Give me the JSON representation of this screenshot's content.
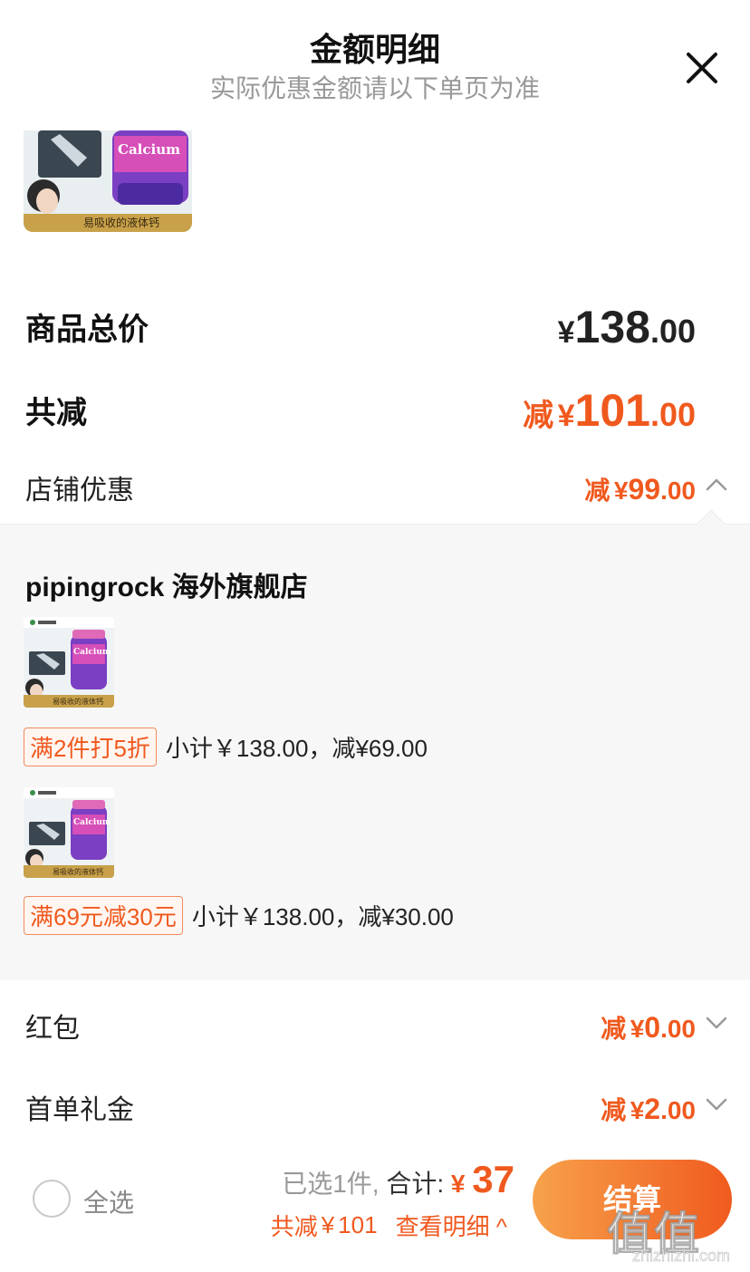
{
  "header": {
    "title": "金额明细",
    "subtitle": "实际优惠金额请以下单页为准"
  },
  "top_product": {
    "banner_text": "易吸收的液体钙",
    "bottle_label": "Calcium"
  },
  "summary_rows": {
    "total": {
      "label": "商品总价",
      "yen": "¥",
      "integer": "138",
      "decimal": ".00"
    },
    "reduce": {
      "label": "共减",
      "prefix": "减",
      "yen": "¥",
      "integer": "101",
      "decimal": ".00"
    },
    "shop_discount": {
      "label": "店铺优惠",
      "prefix": "减",
      "yen": "¥",
      "integer": "99",
      "decimal": ".00",
      "expanded": true
    }
  },
  "detail": {
    "shop_name": "pipingrock 海外旗舰店",
    "items": [
      {
        "banner_text": "易吸收的液体钙",
        "bottle_label": "Calcium",
        "promo_tag": "满2件打5折",
        "promo_text": "小计￥138.00，减¥69.00"
      },
      {
        "banner_text": "易吸收的液体钙",
        "bottle_label": "Calcium",
        "promo_tag": "满69元减30元",
        "promo_text": "小计￥138.00，减¥30.00"
      }
    ]
  },
  "other_rows": {
    "hongbao": {
      "label": "红包",
      "prefix": "减",
      "yen": "¥",
      "integer": "0",
      "decimal": ".00"
    },
    "first_order": {
      "label": "首单礼金",
      "prefix": "减",
      "yen": "¥",
      "integer": "2",
      "decimal": ".00"
    }
  },
  "bottom_bar": {
    "select_all": "全选",
    "selected_count": "已选1件,",
    "total_label": "合计:",
    "total_yen": "¥",
    "total_value": "37",
    "reduce_label": "共减",
    "reduce_yen": "¥",
    "reduce_value": "101",
    "view_detail": "查看明细 ^",
    "checkout_label": "结算"
  },
  "watermark": {
    "main": "值值值",
    "sub": "zhizhizhi.com"
  },
  "colors": {
    "accent": "#f0591e",
    "accent_light": "#f7a24b",
    "muted": "#999999",
    "panel_bg": "#f7f7f7"
  },
  "icons": {
    "close": "close-icon",
    "shop_toggle": "chevron-up-icon",
    "hongbao_toggle": "chevron-down-icon",
    "first_order_toggle": "chevron-down-icon",
    "select_all": "radio-circle-icon"
  }
}
